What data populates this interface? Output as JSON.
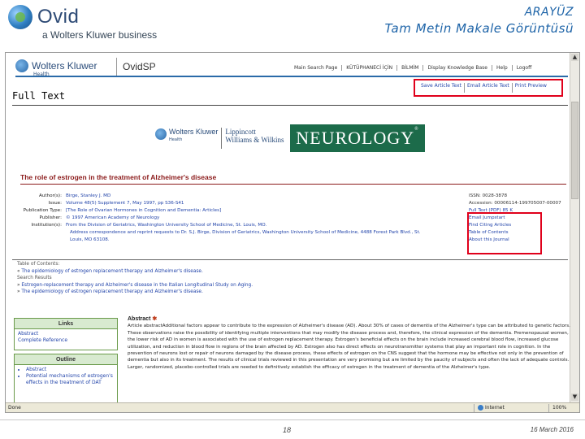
{
  "slide": {
    "brand_name": "Ovid",
    "brand_sub": "a Wolters Kluwer business",
    "title_line1": "ARAYÜZ",
    "title_line2": "Tam Metin Makale Görüntüsü",
    "page_number": "18",
    "date": "16 March 2016"
  },
  "browser": {
    "wk_name": "Wolters Kluwer",
    "wk_health": "Health",
    "ovidsp": "OvidSP",
    "topnav": [
      "Main Search Page",
      "KÜTÜPHANECİ İÇİN",
      "BİLMİM",
      "Display Knowledge Base",
      "Help",
      "Logoff"
    ],
    "subnav": [
      "Save Article Text",
      "Email Article Text",
      "Print Preview"
    ],
    "full_text_heading": "Full Text",
    "publisher_wk": "Wolters Kluwer",
    "publisher_health": "Health",
    "publisher_lww_1": "Lippincott",
    "publisher_lww_2": "Williams & Wilkins",
    "journal": "NEUROLOGY",
    "journal_mark": "®",
    "article_title": "The role of estrogen in the treatment of Alzheimer's disease",
    "meta": [
      {
        "label": "Author(s):",
        "value": "Birge, Stanley J. MD"
      },
      {
        "label": "Issue:",
        "value": "Volume 48(5) Supplement 7, May 1997, pp S36-S41"
      },
      {
        "label": "Publication Type:",
        "value": "[The Role of Ovarian Hormones in Cognition and Dementia: Articles]"
      },
      {
        "label": "Publisher:",
        "value": "© 1997 American Academy of Neurology"
      },
      {
        "label": "Institution(s):",
        "value": "From the Division of Geriatrics, Washington University School of Medicine, St. Louis, MO."
      }
    ],
    "meta_extra_1": "Address correspondence and reprint requests to Dr. S.J. Birge, Division of Geriatrics, Washington University School of Medicine, 4488 Forest Park Blvd., St.",
    "meta_extra_2": "Louis, MO 63108.",
    "side": {
      "issn": "ISSN: 0028-3878",
      "accession": "Accession: 00006114-199705007-00007",
      "links": [
        "Full Text (PDF) 85 K",
        "Email Jumpstart",
        "Find Citing Articles",
        "Table of Contents",
        "About this Journal"
      ]
    },
    "toc": {
      "heading": "Table of Contents:",
      "item1": "The epidemiology of estrogen replacement therapy and Alzheimer's disease.",
      "item2_prefix": "Search Results",
      "item3": "Estrogen-replacement therapy and Alzheimer's disease in the Italian Longitudinal Study on Aging.",
      "item4": "The epidemiology of estrogen replacement therapy and Alzheimer's disease."
    },
    "links_box": {
      "heading": "Links",
      "items": [
        "Abstract",
        "Complete Reference"
      ]
    },
    "outline_box": {
      "heading": "Outline",
      "items": [
        "Abstract",
        "Potential mechanisms of estrogen's effects in the treatment of DAT"
      ]
    },
    "abstract": {
      "heading": "Abstract",
      "star": "✱",
      "text": "Article abstractAdditional factors appear to contribute to the expression of Alzheimer's disease (AD). About 30% of cases of dementia of the Alzheimer's type can be attributed to genetic factors. These observations raise the possibility of identifying multiple interventions that may modify the disease process and, therefore, the clinical expression of the dementia. Premenopausal women, the lower risk of AD in women is associated with the use of estrogen replacement therapy. Estrogen's beneficial effects on the brain include increased cerebral blood flow, increased glucose utilization, and reduction in blood flow in regions of the brain affected by AD. Estrogen also has direct effects on neurotransmitter systems that play an important role in cognition. In the prevention of neurons lost or repair of neurons damaged by the disease process, these effects of estrogen on the CNS suggest that the hormone may be effective not only in the prevention of dementia but also in its treatment. The results of clinical trials reviewed in this presentation are very promising but are limited by the paucity of subjects and often the lack of adequate controls. Larger, randomized, placebo-controlled trials are needed to definitively establish the efficacy of estrogen in the treatment of dementia of the Alzheimer's type."
    },
    "status": {
      "done": "Done",
      "zone": "Internet",
      "zoom": "100%"
    }
  }
}
